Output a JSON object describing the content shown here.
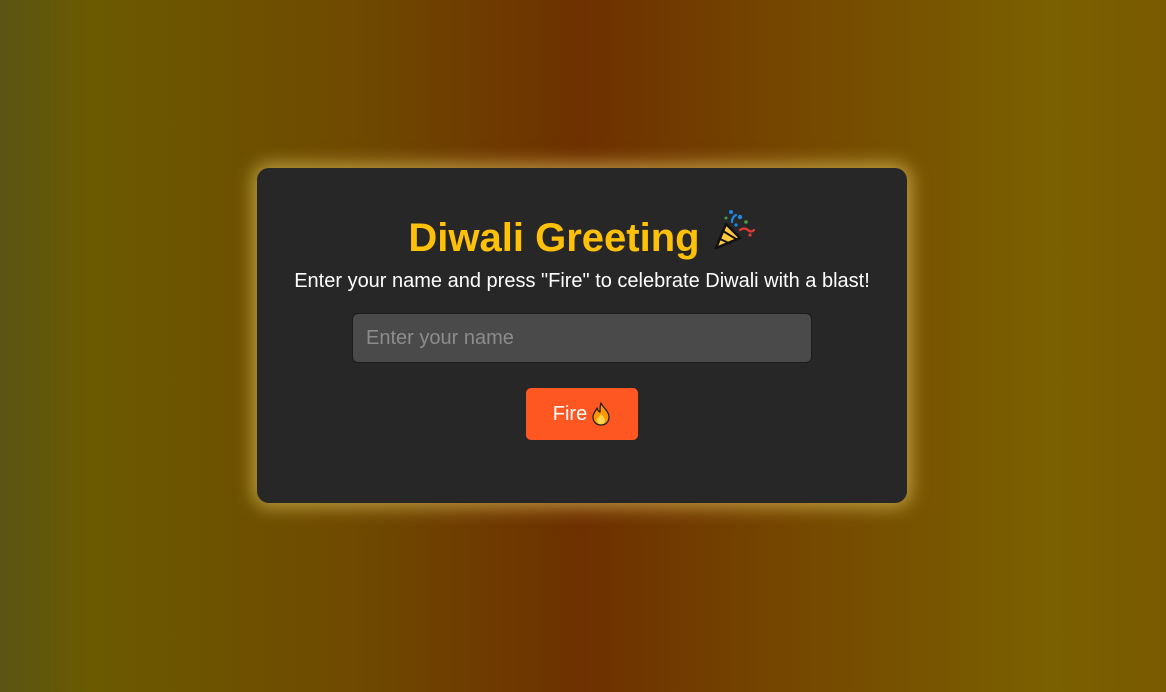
{
  "card": {
    "title": "Diwali Greeting",
    "title_icon": "party-popper-icon",
    "subtitle": "Enter your name and press \"Fire\" to celebrate Diwali with a blast!",
    "name_input": {
      "placeholder": "Enter your name",
      "value": ""
    },
    "fire_button": {
      "label": "Fire",
      "icon": "fire-icon"
    }
  },
  "colors": {
    "title": "#ffc107",
    "card_background": "#272727",
    "button": "#ff5722",
    "glow": "#ffe178"
  }
}
